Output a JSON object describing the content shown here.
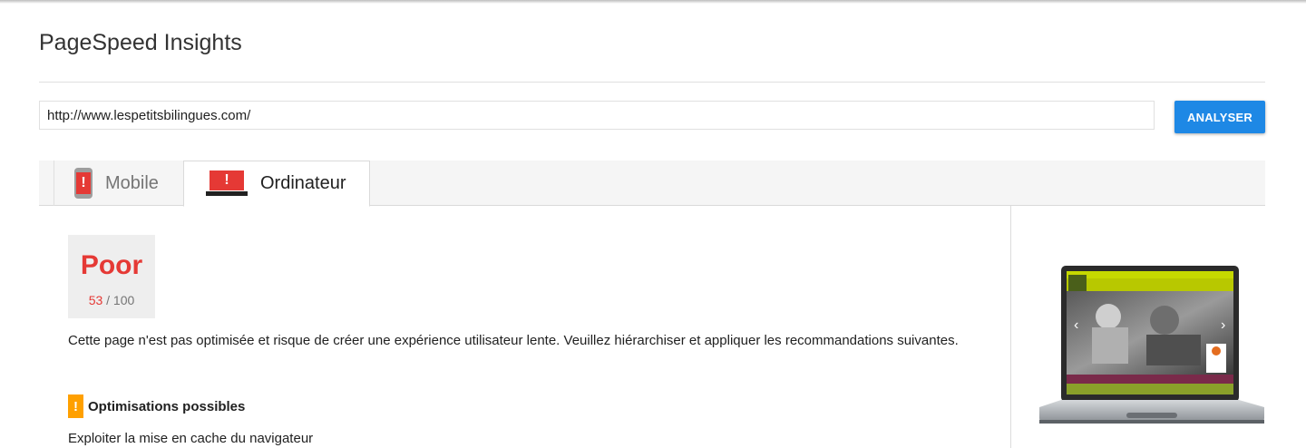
{
  "app": {
    "title": "PageSpeed Insights"
  },
  "search": {
    "url": "http://www.lespetitsbilingues.com/",
    "button_label": "ANALYSER"
  },
  "tabs": [
    {
      "label": "Mobile",
      "icon": "phone-warning-icon",
      "active": false
    },
    {
      "label": "Ordinateur",
      "icon": "laptop-warning-icon",
      "active": true
    }
  ],
  "score": {
    "rating": "Poor",
    "value": "53",
    "max": "/ 100",
    "color": "#e53935"
  },
  "summary": "Cette page n'est pas optimisée et risque de créer une expérience utilisateur lente. Veuillez hiérarchiser et appliquer les recommandations suivantes.",
  "optimizations": {
    "badge": "!",
    "title": "Optimisations possibles",
    "items": [
      "Exploiter la mise en cache du navigateur"
    ]
  },
  "colors": {
    "accent": "#1e88e5",
    "poor": "#e53935",
    "warning": "#ffa000"
  },
  "icons": {
    "tab_warning": "!"
  }
}
